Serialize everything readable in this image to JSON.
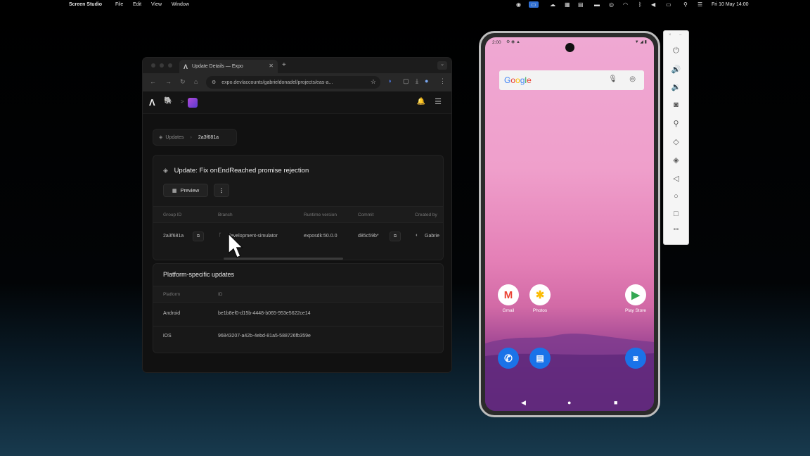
{
  "menubar": {
    "app_name": "Screen Studio",
    "menus": [
      "File",
      "Edit",
      "View",
      "Window"
    ],
    "clock": "Fri 10 May  14:00"
  },
  "browser": {
    "tab_title": "Update Details — Expo",
    "tab_close": "✕",
    "new_tab": "+",
    "url": "expo.dev/accounts/gabrieldonadel/projects/eas-a...",
    "page": {
      "breadcrumb": {
        "parent": "Updates",
        "current": "2a3f681a"
      },
      "update_title": "Update: Fix onEndReached promise rejection",
      "preview_label": "Preview",
      "more_label": "⋮",
      "details_table": {
        "headers": [
          "Group ID",
          "Branch",
          "Runtime version",
          "Commit",
          "Created by"
        ],
        "row": {
          "group_id": "2a3f681a",
          "branch": "development-simulator",
          "runtime_version": "exposdk:50.0.0",
          "commit": "d85c59b*",
          "created_by": "Gabrie"
        }
      },
      "platform_section": {
        "title": "Platform-specific updates",
        "headers": [
          "Platform",
          "ID"
        ],
        "rows": [
          {
            "platform": "Android",
            "id": "be1b8ef0-d15b-4448-b065-953e5622ce14"
          },
          {
            "platform": "iOS",
            "id": "96843207-a42b-4ebd-81a5-588726fb359e"
          }
        ]
      }
    }
  },
  "phone": {
    "status_time": "2:00",
    "search_logo": [
      "G",
      "o",
      "o",
      "g",
      "l",
      "e"
    ],
    "apps": [
      {
        "label": "Gmail",
        "icon": "gmail-icon"
      },
      {
        "label": "Photos",
        "icon": "photos-icon"
      },
      {
        "label": "Play Store",
        "icon": "play-store-icon"
      }
    ],
    "dock": [
      "phone-icon",
      "messages-icon",
      "camera-icon"
    ]
  },
  "emulator_panel": {
    "buttons": [
      "power-icon",
      "volume-up-icon",
      "volume-down-icon",
      "screenshot-icon",
      "zoom-icon",
      "rotate-left-icon",
      "rotate-right-icon",
      "back-icon",
      "home-icon",
      "overview-icon",
      "more-icon"
    ],
    "more_label": "•••"
  }
}
